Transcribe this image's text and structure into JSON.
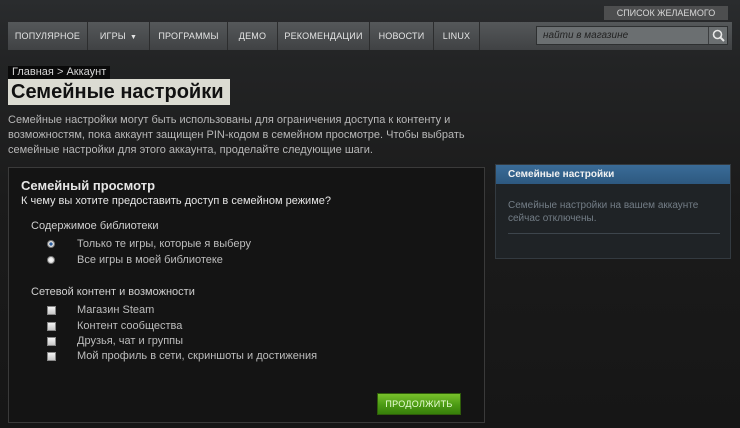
{
  "header": {
    "wishlist_label": "СПИСОК ЖЕЛАЕМОГО"
  },
  "nav": {
    "items": [
      {
        "label": "ПОПУЛЯРНОЕ"
      },
      {
        "label": "ИГРЫ"
      },
      {
        "label": "ПРОГРАММЫ"
      },
      {
        "label": "ДЕМО"
      },
      {
        "label": "РЕКОМЕНДАЦИИ"
      },
      {
        "label": "НОВОСТИ"
      },
      {
        "label": "LINUX"
      }
    ]
  },
  "search": {
    "placeholder": "найти в магазине"
  },
  "breadcrumb": {
    "home": "Главная",
    "separator": ">",
    "current": "Аккаунт"
  },
  "page": {
    "title": "Семейные настройки",
    "intro": "Семейные настройки могут быть использованы для ограничения доступа к контенту и возможностям, пока аккаунт защищен PIN-кодом в семейном просмотре. Чтобы выбрать семейные настройки для этого аккаунта, проделайте следующие шаги."
  },
  "panel": {
    "title": "Семейный просмотр",
    "question": "К чему вы хотите предоставить доступ в семейном режиме?",
    "library": {
      "label": "Содержимое библиотеки",
      "options": [
        {
          "label": "Только те игры, которые я выберу",
          "selected": true
        },
        {
          "label": "Все игры в моей библиотеке",
          "selected": false
        }
      ]
    },
    "online": {
      "label": "Сетевой контент и возможности",
      "options": [
        {
          "label": "Магазин Steam",
          "checked": false
        },
        {
          "label": "Контент сообщества",
          "checked": false
        },
        {
          "label": "Друзья, чат и группы",
          "checked": false
        },
        {
          "label": "Мой профиль в сети, скриншоты и достижения",
          "checked": false
        }
      ]
    },
    "continue_label": "ПРОДОЛЖИТЬ"
  },
  "sidebar": {
    "title": "Семейные настройки",
    "text": "Семейные настройки на вашем аккаунте сейчас отключены."
  },
  "colors": {
    "accent_blue": "#3a6c98",
    "button_green": "#5aa81c",
    "title_bg": "#dbdbd2"
  }
}
